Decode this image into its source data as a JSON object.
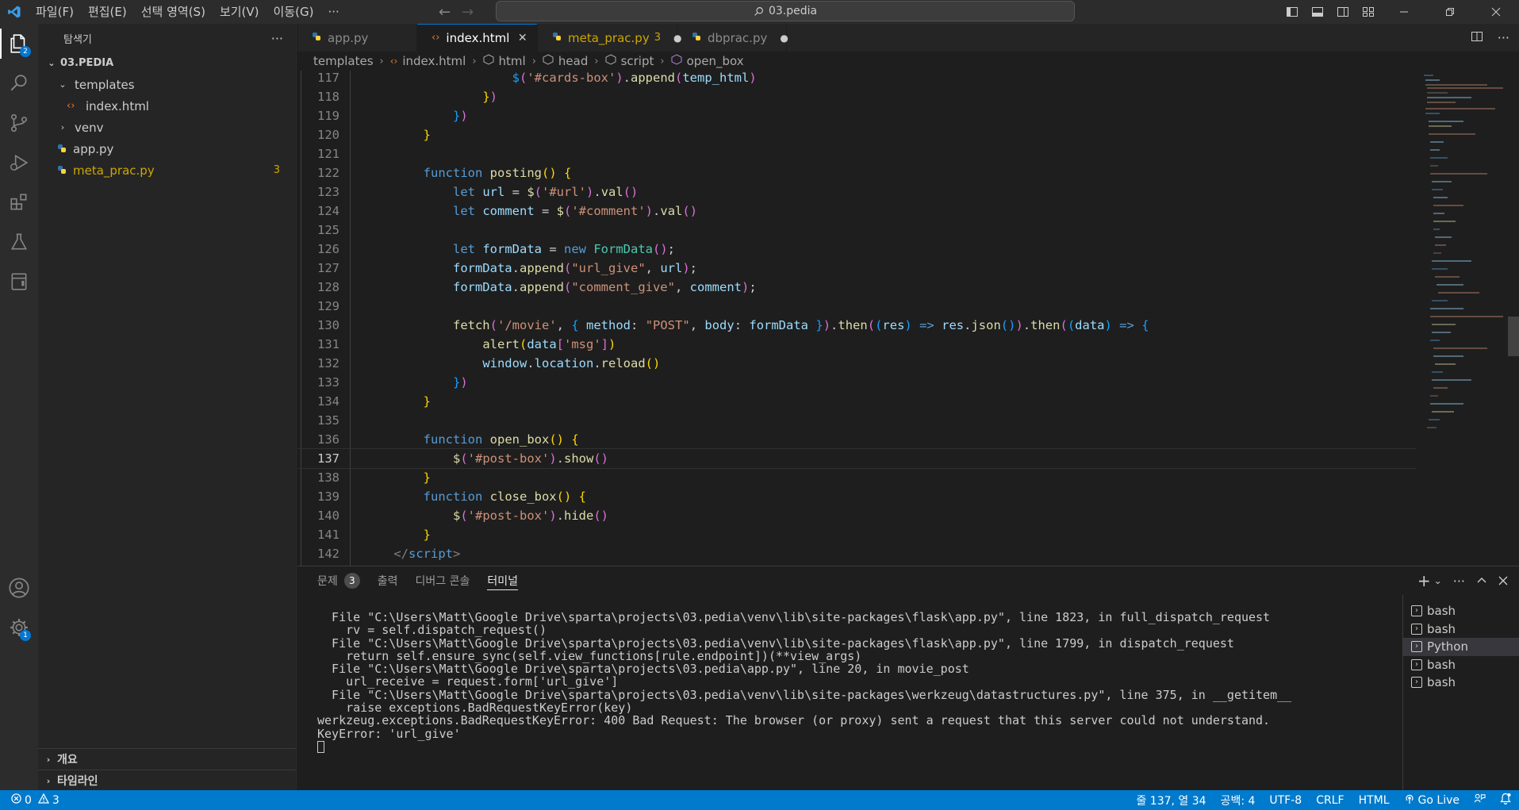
{
  "titlebar": {
    "menu": [
      "파일(F)",
      "편집(E)",
      "선택 영역(S)",
      "보기(V)",
      "이동(G)",
      "···"
    ],
    "search_text": "03.pedia"
  },
  "activity_bar": {
    "explorer_badge": "2",
    "manage_badge": "1"
  },
  "sidebar": {
    "title": "탐색기",
    "more": "···",
    "root": "03.PEDIA",
    "items": [
      {
        "label": "templates",
        "type": "folder-open"
      },
      {
        "label": "index.html",
        "type": "html"
      },
      {
        "label": "venv",
        "type": "folder"
      },
      {
        "label": "app.py",
        "type": "python"
      },
      {
        "label": "meta_prac.py",
        "type": "python",
        "badge": "3"
      }
    ],
    "outline": "개요",
    "timeline": "타임라인"
  },
  "tabs": [
    {
      "label": "app.py",
      "icon": "python-icon"
    },
    {
      "label": "index.html",
      "icon": "html-icon",
      "active": true
    },
    {
      "label": "meta_prac.py",
      "icon": "python-icon",
      "count": "3"
    },
    {
      "label": "dbprac.py",
      "icon": "python-icon"
    }
  ],
  "breadcrumb": [
    "templates",
    "index.html",
    "html",
    "head",
    "script",
    "open_box"
  ],
  "editor": {
    "line_numbers": [
      "117",
      "118",
      "119",
      "120",
      "121",
      "122",
      "123",
      "124",
      "125",
      "126",
      "127",
      "128",
      "129",
      "130",
      "131",
      "132",
      "133",
      "134",
      "135",
      "136",
      "137",
      "138",
      "139",
      "140",
      "141",
      "142"
    ],
    "current_line": "137"
  },
  "panel": {
    "tabs": [
      "문제",
      "출력",
      "디버그 콘솔",
      "터미널"
    ],
    "problems_count": "3",
    "terminal_lines": [
      "  File \"C:\\Users\\Matt\\Google Drive\\sparta\\projects\\03.pedia\\venv\\lib\\site-packages\\flask\\app.py\", line 1823, in full_dispatch_request",
      "    rv = self.dispatch_request()",
      "  File \"C:\\Users\\Matt\\Google Drive\\sparta\\projects\\03.pedia\\venv\\lib\\site-packages\\flask\\app.py\", line 1799, in dispatch_request",
      "    return self.ensure_sync(self.view_functions[rule.endpoint])(**view_args)",
      "  File \"C:\\Users\\Matt\\Google Drive\\sparta\\projects\\03.pedia\\app.py\", line 20, in movie_post",
      "    url_receive = request.form['url_give']",
      "  File \"C:\\Users\\Matt\\Google Drive\\sparta\\projects\\03.pedia\\venv\\lib\\site-packages\\werkzeug\\datastructures.py\", line 375, in __getitem__",
      "    raise exceptions.BadRequestKeyError(key)",
      "werkzeug.exceptions.BadRequestKeyError: 400 Bad Request: The browser (or proxy) sent a request that this server could not understand.",
      "KeyError: 'url_give'"
    ],
    "terminals": [
      "bash",
      "bash",
      "Python",
      "bash",
      "bash"
    ]
  },
  "statusbar": {
    "errors": "0",
    "warnings": "3",
    "position": "줄 137, 열 34",
    "spaces": "공백: 4",
    "encoding": "UTF-8",
    "eol": "CRLF",
    "language": "HTML",
    "golive": "Go Live"
  },
  "colors": {
    "accent": "#007acc",
    "background": "#1e1e1e",
    "sidebar": "#252526",
    "warning_text": "#cca700"
  }
}
